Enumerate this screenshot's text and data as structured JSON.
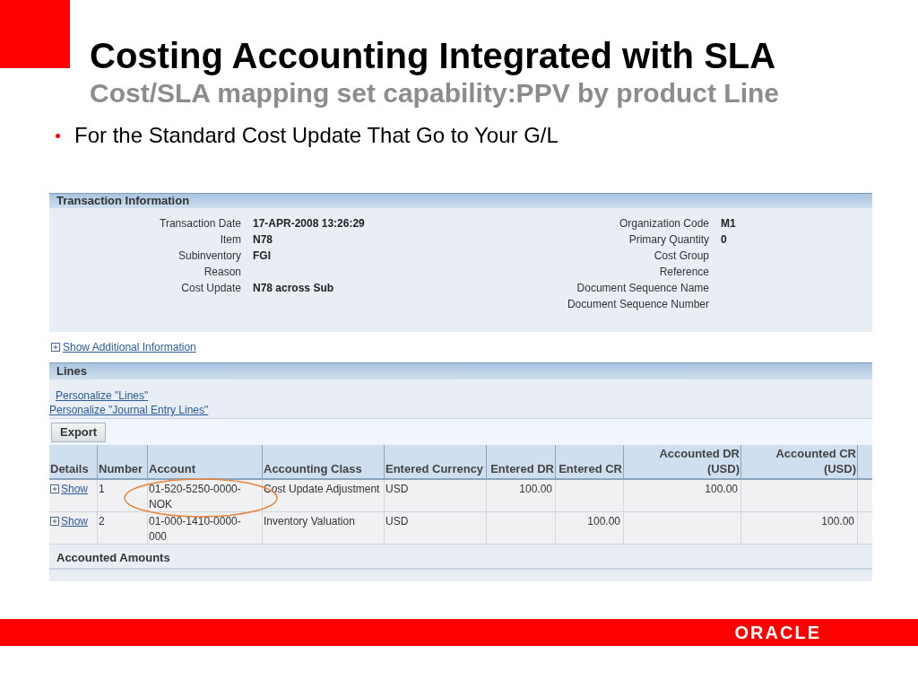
{
  "title": "Costing Accounting Integrated with SLA",
  "subtitle": "Cost/SLA mapping set capability:PPV by product Line",
  "bullets": [
    "For the Standard Cost Update That Go to Your G/L"
  ],
  "transaction_information": {
    "heading": "Transaction Information",
    "left_fields": [
      {
        "label": "Transaction Date",
        "value": "17-APR-2008 13:26:29"
      },
      {
        "label": "Item",
        "value": "N78"
      },
      {
        "label": "Subinventory",
        "value": "FGI"
      },
      {
        "label": "Reason"
      },
      {
        "label": "Cost Update",
        "value": "N78 across Sub"
      }
    ],
    "right_fields": [
      {
        "label": "Organization Code",
        "value": "M1"
      },
      {
        "label": "Primary Quantity",
        "value": "0"
      },
      {
        "label": "Cost Group"
      },
      {
        "label": "Reference"
      },
      {
        "label": "Document Sequence Name"
      },
      {
        "label": "Document Sequence Number"
      }
    ],
    "expander": {
      "label": "Show Additional Information"
    }
  },
  "lines": {
    "heading": "Lines",
    "links": [
      "Personalize \"Lines\"",
      "Personalize \"Journal Entry Lines\""
    ],
    "export_button": "Export",
    "table": {
      "columns": [
        "Details",
        "Number",
        "Account",
        "Accounting Class",
        "Entered Currency",
        "Entered DR",
        "Entered CR",
        "Accounted DR (USD)",
        "Accounted CR (USD)"
      ],
      "rows": [
        {
          "details": "Show",
          "number": "1",
          "account": "01-520-5250-0000-NOK",
          "class": "Cost Update Adjustment",
          "currency": "USD",
          "entered_dr": "100.00",
          "accounted_dr": "100.00"
        },
        {
          "details": "Show",
          "number": "2",
          "account": "01-000-1410-0000-000",
          "class": "Inventory Valuation",
          "currency": "USD",
          "entered_cr": "100.00",
          "accounted_cr": "100.00"
        }
      ],
      "annotations": [
        {
          "kind": "ellipse"
        }
      ]
    }
  },
  "accounted_amounts": {
    "heading": "Accounted Amounts"
  },
  "footer": {
    "logo": "ORACLE"
  }
}
